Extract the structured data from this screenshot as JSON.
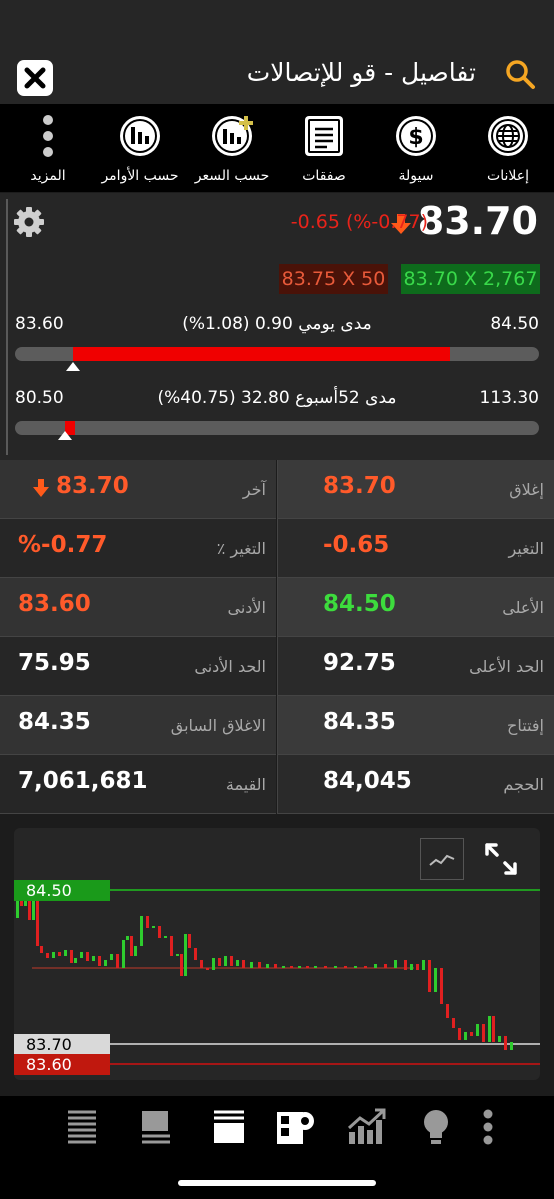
{
  "header": {
    "title": "تفاصيل - قو للإتصالات"
  },
  "toolbar": {
    "items": [
      {
        "label": "إعلانات",
        "icon": "globe-icon"
      },
      {
        "label": "سيولة",
        "icon": "dollar-icon"
      },
      {
        "label": "صفقات",
        "icon": "document-icon"
      },
      {
        "label": "حسب السعر",
        "icon": "bar-chart-plus-icon"
      },
      {
        "label": "حسب الأوامر",
        "icon": "bar-chart-icon"
      },
      {
        "label": "المزيد",
        "icon": "more-vertical-icon"
      }
    ]
  },
  "quote": {
    "price": "83.70",
    "change": "-0.65 (%-0.77)",
    "bid": "83.70 X 2,767",
    "ask": "83.75 X 50",
    "daily_range": {
      "low": "83.60",
      "high": "84.50",
      "label": "مدى يومي 0.90 (1.08%)",
      "fill_start": 0.11,
      "fill_end": 0.83,
      "marker": 0.11
    },
    "week52_range": {
      "low": "80.50",
      "high": "113.30",
      "label": "مدى 52أسبوع 32.80 (40.75%)",
      "fill_start": 0.095,
      "fill_end": 0.115,
      "marker": 0.095
    }
  },
  "stats": [
    {
      "label": "إغلاق",
      "value": "83.70",
      "color": "#ff5a2a"
    },
    {
      "label": "آخر",
      "value": "83.70",
      "color": "#ff5a2a"
    },
    {
      "label": "التغير",
      "value": "-0.65",
      "color": "#ff5a2a"
    },
    {
      "label": "التغير ٪",
      "value": "%-0.77",
      "color": "#ff5a2a"
    },
    {
      "label": "الأعلى",
      "value": "84.50",
      "color": "#3ddc3d"
    },
    {
      "label": "الأدنى",
      "value": "83.60",
      "color": "#ff5a2a"
    },
    {
      "label": "الحد الأعلى",
      "value": "92.75",
      "color": "#ffffff"
    },
    {
      "label": "الحد الأدنى",
      "value": "75.95",
      "color": "#ffffff"
    },
    {
      "label": "إفتتاح",
      "value": "84.35",
      "color": "#ffffff"
    },
    {
      "label": "الاغلاق السابق",
      "value": "84.35",
      "color": "#ffffff"
    },
    {
      "label": "الحجم",
      "value": "84,045",
      "color": "#ffffff"
    },
    {
      "label": "القيمة",
      "value": "7,061,681",
      "color": "#ffffff"
    }
  ],
  "chart": {
    "high_label": "84.50",
    "last_label": "83.70",
    "low_label": "83.60"
  },
  "bottom_nav": [
    "list-icon",
    "table-icon",
    "order-book-icon",
    "settings-panel-icon",
    "chart-growth-icon",
    "lightbulb-icon",
    "more-icon"
  ]
}
